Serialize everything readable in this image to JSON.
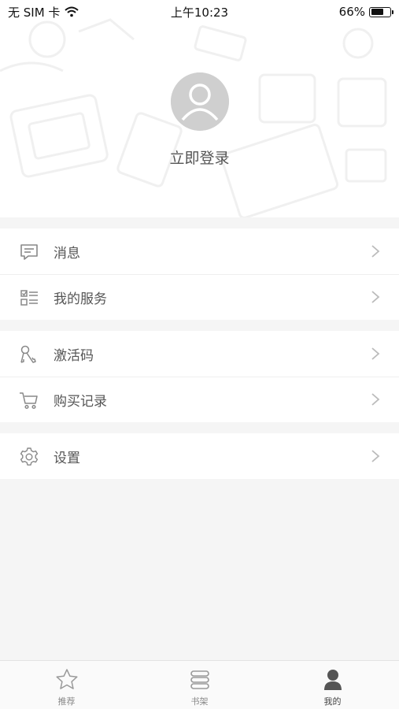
{
  "status_bar": {
    "carrier": "无 SIM 卡",
    "time": "上午10:23",
    "battery_percent": "66%",
    "battery_level": 0.66,
    "wifi_icon": "wifi-icon"
  },
  "profile": {
    "avatar_icon": "user-avatar-icon",
    "login_label": "立即登录"
  },
  "menu": {
    "groups": [
      {
        "items": [
          {
            "label": "消息",
            "icon": "message-icon"
          },
          {
            "label": "我的服务",
            "icon": "service-list-icon"
          }
        ]
      },
      {
        "items": [
          {
            "label": "激活码",
            "icon": "key-icon"
          },
          {
            "label": "购买记录",
            "icon": "cart-icon"
          }
        ]
      },
      {
        "items": [
          {
            "label": "设置",
            "icon": "gear-icon"
          }
        ]
      }
    ]
  },
  "tabbar": {
    "tabs": [
      {
        "label": "推荐",
        "icon": "star-icon",
        "active": false
      },
      {
        "label": "书架",
        "icon": "bookshelf-icon",
        "active": false
      },
      {
        "label": "我的",
        "icon": "person-icon",
        "active": true
      }
    ]
  }
}
